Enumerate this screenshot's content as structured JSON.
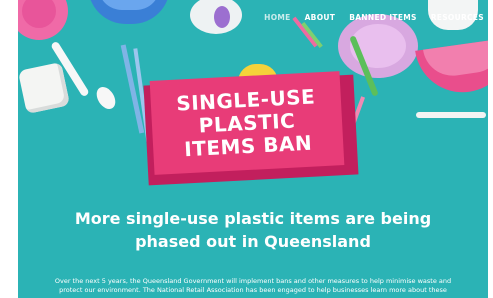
{
  "nav": {
    "items": [
      {
        "label": "HOME",
        "active": true
      },
      {
        "label": "ABOUT",
        "active": false
      },
      {
        "label": "BANNED ITEMS",
        "active": false
      },
      {
        "label": "RESOURCES",
        "active": false
      }
    ]
  },
  "banner": {
    "lines": [
      "SINGLE-USE",
      "PLASTIC",
      "ITEMS BAN"
    ]
  },
  "headline": {
    "line1": "More single-use plastic items are being",
    "line2": "phased out in Queensland"
  },
  "intro": {
    "line1": "Over the next 5 years, the Queensland Government will implement bans and other measures to help minimise waste and",
    "line2": "protect our environment. The National Retail Association has been engaged to help businesses learn more about these"
  },
  "colors": {
    "background": "#2bb3b5",
    "banner": "#e83c78",
    "banner_shadow": "#c21f5d",
    "text": "#ffffff"
  }
}
